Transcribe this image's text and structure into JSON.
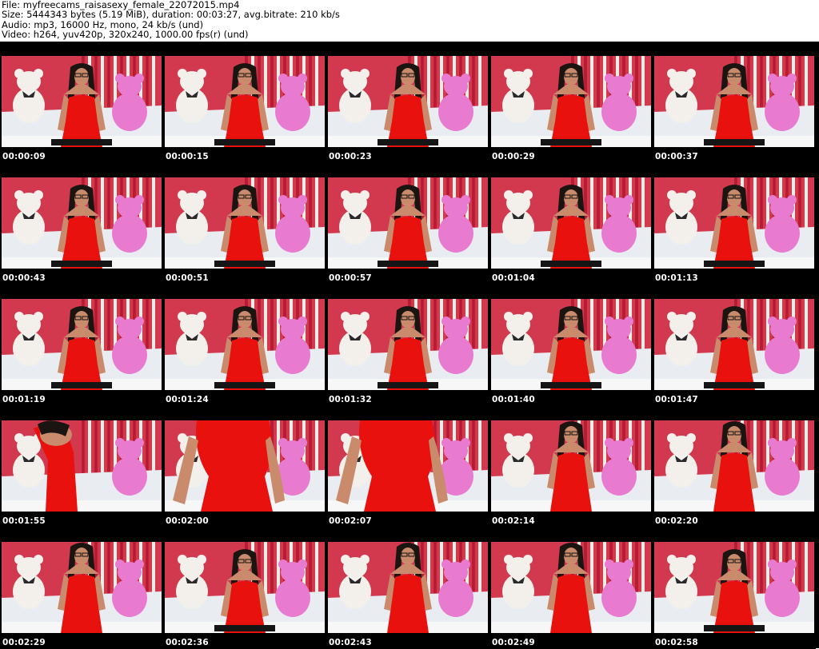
{
  "header": {
    "file": "File: myfreecams_raisasexy_female_22072015.mp4",
    "size": "Size: 5444343 bytes (5.19 MiB), duration: 00:03:27, avg.bitrate: 210 kb/s",
    "audio": "Audio: mp3, 16000 Hz, mono, 24 kb/s (und)",
    "video": "Video: h264, yuv420p, 320x240, 1000.00 fps(r) (und)"
  },
  "colors": {
    "wall": "#d2384e",
    "stripe_light": "#eeeae4",
    "stripe_red": "#b81c32",
    "bed": "#e9ecf1",
    "white_bear": "#f3f0ec",
    "pink_bear": "#e87ad0",
    "dress": "#e8110d",
    "skin": "#c98b6b",
    "hair": "#1b1511",
    "timestamp": "#ffffff"
  },
  "thumbnails": [
    {
      "time": "00:00:09",
      "pose": "sit"
    },
    {
      "time": "00:00:15",
      "pose": "sit"
    },
    {
      "time": "00:00:23",
      "pose": "sit"
    },
    {
      "time": "00:00:29",
      "pose": "sit"
    },
    {
      "time": "00:00:37",
      "pose": "sit"
    },
    {
      "time": "00:00:43",
      "pose": "sit"
    },
    {
      "time": "00:00:51",
      "pose": "sit"
    },
    {
      "time": "00:00:57",
      "pose": "sit"
    },
    {
      "time": "00:01:04",
      "pose": "sit"
    },
    {
      "time": "00:01:13",
      "pose": "sit"
    },
    {
      "time": "00:01:19",
      "pose": "sit"
    },
    {
      "time": "00:01:24",
      "pose": "sit"
    },
    {
      "time": "00:01:32",
      "pose": "sit"
    },
    {
      "time": "00:01:40",
      "pose": "sit"
    },
    {
      "time": "00:01:47",
      "pose": "sit"
    },
    {
      "time": "00:01:55",
      "pose": "lean"
    },
    {
      "time": "00:02:00",
      "pose": "close"
    },
    {
      "time": "00:02:07",
      "pose": "close"
    },
    {
      "time": "00:02:14",
      "pose": "stand"
    },
    {
      "time": "00:02:20",
      "pose": "stand"
    },
    {
      "time": "00:02:29",
      "pose": "stand"
    },
    {
      "time": "00:02:36",
      "pose": "sit"
    },
    {
      "time": "00:02:43",
      "pose": "stand"
    },
    {
      "time": "00:02:49",
      "pose": "stand"
    },
    {
      "time": "00:02:58",
      "pose": "sit"
    }
  ]
}
